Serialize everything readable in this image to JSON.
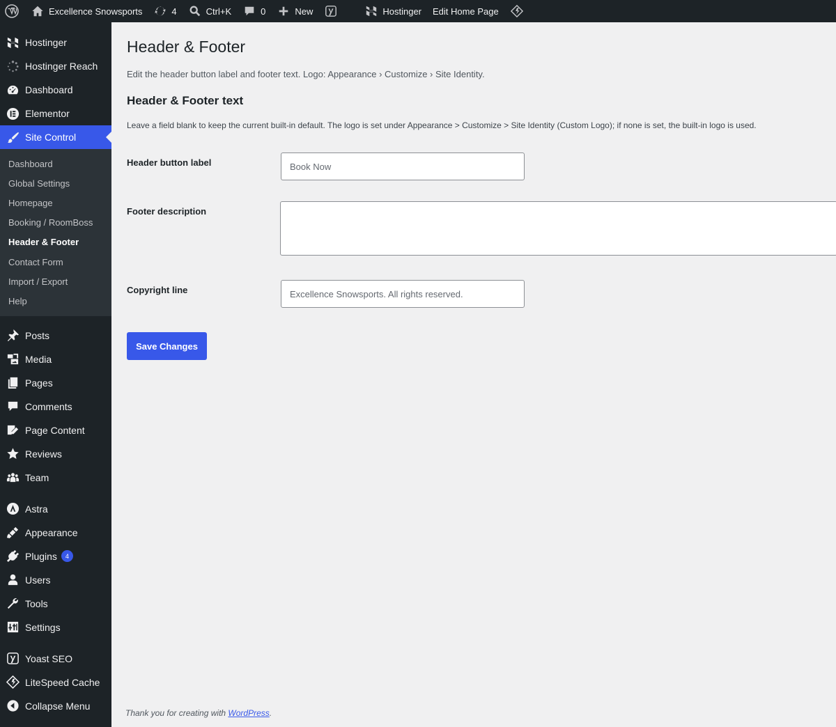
{
  "admin_bar": {
    "site_name": "Excellence Snowsports",
    "updates_count": "4",
    "search_shortcut": "Ctrl+K",
    "comments_count": "0",
    "new_label": "New",
    "hostinger_label": "Hostinger",
    "edit_label": "Edit Home Page"
  },
  "sidebar": {
    "top_items": [
      {
        "label": "Hostinger",
        "icon": "hostinger-icon"
      },
      {
        "label": "Hostinger Reach",
        "icon": "spinner-icon"
      },
      {
        "label": "Dashboard",
        "icon": "dashboard-icon"
      },
      {
        "label": "Elementor",
        "icon": "elementor-icon"
      },
      {
        "label": "Site Control",
        "icon": "brush-icon"
      }
    ],
    "submenu": [
      "Dashboard",
      "Global Settings",
      "Homepage",
      "Booking / RoomBoss",
      "Header & Footer",
      "Contact Form",
      "Import / Export",
      "Help"
    ],
    "content_items": [
      {
        "label": "Posts",
        "icon": "pin-icon"
      },
      {
        "label": "Media",
        "icon": "media-icon"
      },
      {
        "label": "Pages",
        "icon": "pages-icon"
      },
      {
        "label": "Comments",
        "icon": "comment-icon"
      },
      {
        "label": "Page Content",
        "icon": "edit-page-icon"
      },
      {
        "label": "Reviews",
        "icon": "star-icon"
      },
      {
        "label": "Team",
        "icon": "groups-icon"
      }
    ],
    "admin_items": [
      {
        "label": "Astra",
        "icon": "astra-icon"
      },
      {
        "label": "Appearance",
        "icon": "appearance-icon"
      },
      {
        "label": "Plugins",
        "icon": "plugins-icon",
        "badge": "4"
      },
      {
        "label": "Users",
        "icon": "users-icon"
      },
      {
        "label": "Tools",
        "icon": "wrench-icon"
      },
      {
        "label": "Settings",
        "icon": "settings-icon"
      }
    ],
    "bottom_items": [
      {
        "label": "Yoast SEO",
        "icon": "yoast-icon"
      },
      {
        "label": "LiteSpeed Cache",
        "icon": "litespeed-icon"
      },
      {
        "label": "Collapse Menu",
        "icon": "collapse-icon"
      }
    ]
  },
  "main": {
    "title": "Header & Footer",
    "intro": "Edit the header button label and footer text. Logo: Appearance › Customize › Site Identity.",
    "section_title": "Header & Footer text",
    "section_desc": "Leave a field blank to keep the current built-in default. The logo is set under Appearance > Customize > Site Identity (Custom Logo); if none is set, the built-in logo is used.",
    "fields": {
      "header_button_label": "Header button label",
      "header_button_placeholder": "Book Now",
      "footer_description_label": "Footer description",
      "copyright_label": "Copyright line",
      "copyright_placeholder": "Excellence Snowsports. All rights reserved."
    },
    "save_label": "Save Changes"
  },
  "footer": {
    "text": "Thank you for creating with ",
    "link": "WordPress",
    "suffix": "."
  },
  "colors": {
    "accent": "#3858e9",
    "adminbar_bg": "#1d2327",
    "page_bg": "#f0f0f1"
  }
}
